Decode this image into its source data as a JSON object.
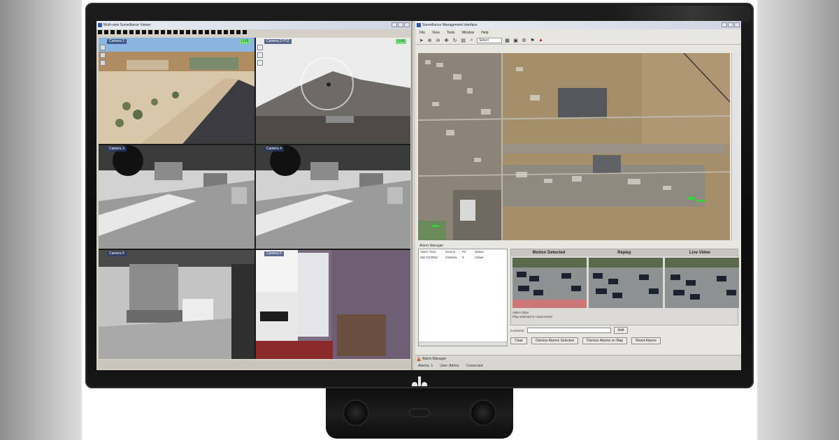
{
  "left_window": {
    "title": "Multi-view Surveillance Viewer",
    "cameras": [
      {
        "label": "Camera 1",
        "rec": "LIVE"
      },
      {
        "label": "Camera 2 PTZ",
        "rec": "LIVE"
      },
      {
        "label": "Camera 3"
      },
      {
        "label": "Camera 4"
      },
      {
        "label": "Camera 5"
      },
      {
        "label": "Camera 6"
      }
    ],
    "status": ""
  },
  "right_window": {
    "title": "Surveillance Management Interface",
    "menu": [
      "File",
      "View",
      "Tools",
      "Window",
      "Help"
    ],
    "toolbar_field": "Select",
    "bottom_title": "Alarm Manager",
    "alarm_columns": [
      "Alarm Time",
      "Source",
      "Pri",
      "Status"
    ],
    "alarm_rows": [
      [
        "Sat 7/1/2011",
        "Camera",
        "3",
        "Active"
      ]
    ],
    "clip_headers": [
      "Motion Detected",
      "Replay",
      "Live Video"
    ],
    "clip_controls_title": "Alarm Clips",
    "clip_controls_text": "Play selected or most recent",
    "clip_desc_label": "Comment",
    "clip_desc_button": "Add",
    "buttons": [
      "Clear",
      "Dismiss Alarms Selected",
      "Dismiss Alarms on Map",
      "Reset Alarms"
    ],
    "status_line1": "Alarm Manager",
    "status_items": [
      "Alarms: 1",
      "User: Admin",
      "Connected"
    ]
  },
  "colors": {
    "monitor": "#111111",
    "accent": "#2a5aa8",
    "ptz_ring": "#ffffff"
  }
}
